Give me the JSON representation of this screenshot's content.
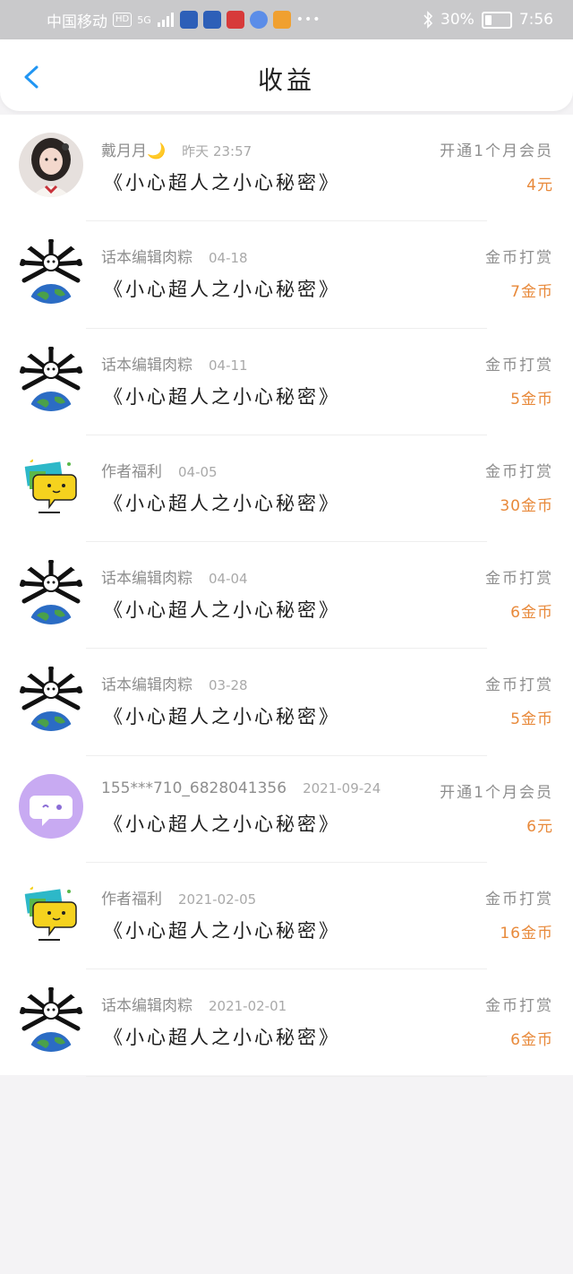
{
  "status_bar": {
    "carrier": "中国移动",
    "hd": "HD",
    "signal": "5G",
    "battery": "30%",
    "time": "7:56",
    "battery_level": 0.3
  },
  "header": {
    "title": "收益"
  },
  "colors": {
    "accent_blue": "#2196f3",
    "amount_orange": "#e8893a"
  },
  "items": [
    {
      "name": "戴月月",
      "emoji": "🌙",
      "date": "昨天 23:57",
      "book": "《小心超人之小心秘密》",
      "type": "开通1个月会员",
      "amount": "4元",
      "avatar": "photo"
    },
    {
      "name": "话本编辑肉粽",
      "date": "04-18",
      "book": "《小心超人之小心秘密》",
      "type": "金币打赏",
      "amount": "7金币",
      "avatar": "spider-earth"
    },
    {
      "name": "话本编辑肉粽",
      "date": "04-11",
      "book": "《小心超人之小心秘密》",
      "type": "金币打赏",
      "amount": "5金币",
      "avatar": "spider-earth"
    },
    {
      "name": "作者福利",
      "date": "04-05",
      "book": "《小心超人之小心秘密》",
      "type": "金币打赏",
      "amount": "30金币",
      "avatar": "chat-bubble"
    },
    {
      "name": "话本编辑肉粽",
      "date": "04-04",
      "book": "《小心超人之小心秘密》",
      "type": "金币打赏",
      "amount": "6金币",
      "avatar": "spider-earth"
    },
    {
      "name": "话本编辑肉粽",
      "date": "03-28",
      "book": "《小心超人之小心秘密》",
      "type": "金币打赏",
      "amount": "5金币",
      "avatar": "spider-earth"
    },
    {
      "name": "155***710_6828041356",
      "date": "2021-09-24",
      "book": "《小心超人之小心秘密》",
      "type": "开通1个月会员",
      "amount": "6元",
      "avatar": "purple-chat"
    },
    {
      "name": "作者福利",
      "date": "2021-02-05",
      "book": "《小心超人之小心秘密》",
      "type": "金币打赏",
      "amount": "16金币",
      "avatar": "chat-bubble"
    },
    {
      "name": "话本编辑肉粽",
      "date": "2021-02-01",
      "book": "《小心超人之小心秘密》",
      "type": "金币打赏",
      "amount": "6金币",
      "avatar": "spider-earth"
    }
  ]
}
